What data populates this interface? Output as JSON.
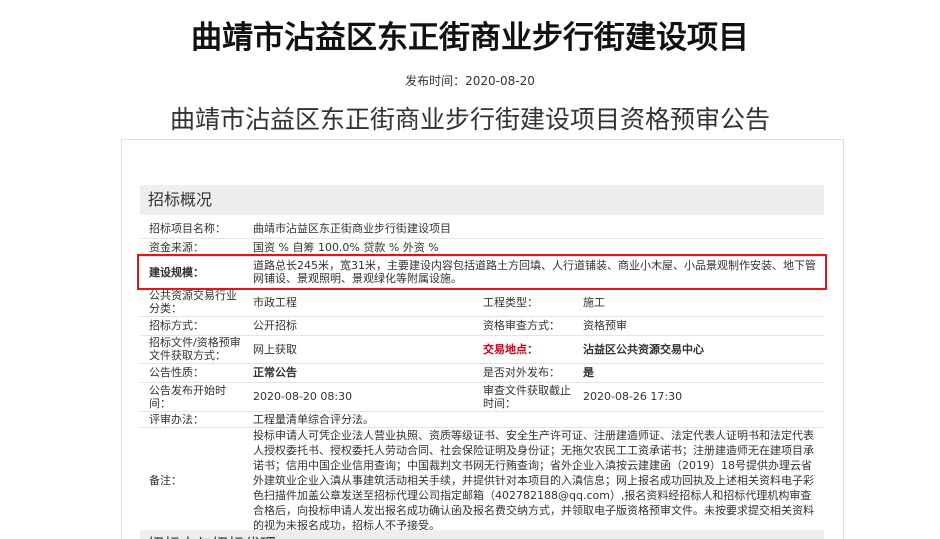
{
  "page": {
    "title": "曲靖市沾益区东正街商业步行街建设项目",
    "publish_label": "发布时间：",
    "publish_date": "2020-08-20",
    "subtitle": "曲靖市沾益区东正街商业步行街建设项目资格预审公告"
  },
  "section": {
    "heading": "招标概况",
    "next_heading": "招标人与招标代理"
  },
  "rows": {
    "project_name": {
      "label": "招标项目名称：",
      "value": "曲靖市沾益区东正街商业步行街建设项目"
    },
    "fund_source": {
      "label": "资金来源：",
      "value": "国资 % 自筹 100.0% 贷款 % 外资 %"
    },
    "scale": {
      "label": "建设规模：",
      "value": "道路总长245米，宽31米，主要建设内容包括道路土方回填、人行道铺装、商业小木屋、小品景观制作安装、地下管网铺设、景观照明、景观绿化等附属设施。"
    },
    "category": {
      "label": "公共资源交易行业分类：",
      "value": "市政工程",
      "label2": "工程类型：",
      "value2": "施工"
    },
    "method": {
      "label": "招标方式：",
      "value": "公开招标",
      "label2": "资格审查方式：",
      "value2": "资格预审"
    },
    "obtain": {
      "label": "招标文件/资格预审文件获取方式：",
      "value": "网上获取",
      "label2": "交易地点：",
      "value2": "沾益区公共资源交易中心"
    },
    "nature": {
      "label": "公告性质：",
      "value": "正常公告",
      "label2": "是否对外发布：",
      "value2": "是"
    },
    "time": {
      "label": "公告发布开始时间：",
      "value": "2020-08-20 08:30",
      "label2": "审查文件获取截止时间：",
      "value2": "2020-08-26 17:30"
    },
    "evaluation": {
      "label": "评审办法：",
      "value": "工程量清单综合评分法。"
    },
    "remarks": {
      "label": "备注：",
      "value": "投标申请人可凭企业法人营业执照、资质等级证书、安全生产许可证、注册建造师证、法定代表人证明书和法定代表人授权委托书、授权委托人劳动合同、社会保险证明及身份证；无拖欠农民工工资承诺书；注册建造师无在建项目承诺书；信用中国企业信用查询；中国裁判文书网无行贿查询；省外企业入滇按云建建函（2019）18号提供办理云省外建筑业企业入滇从事建筑活动相关手续，并提供针对本项目的入滇信息；网上报名成功回执及上述相关资料电子彩色扫描件加盖公章发送至招标代理公司指定邮箱（402782188@qq.com）,报名资料经招标人和招标代理机构审查合格后，向投标申请人发出报名成功确认函及报名费交纳方式，并领取电子版资格预审文件。未按要求提交相关资料的视为未报名成功，招标人不予接受。"
    }
  }
}
